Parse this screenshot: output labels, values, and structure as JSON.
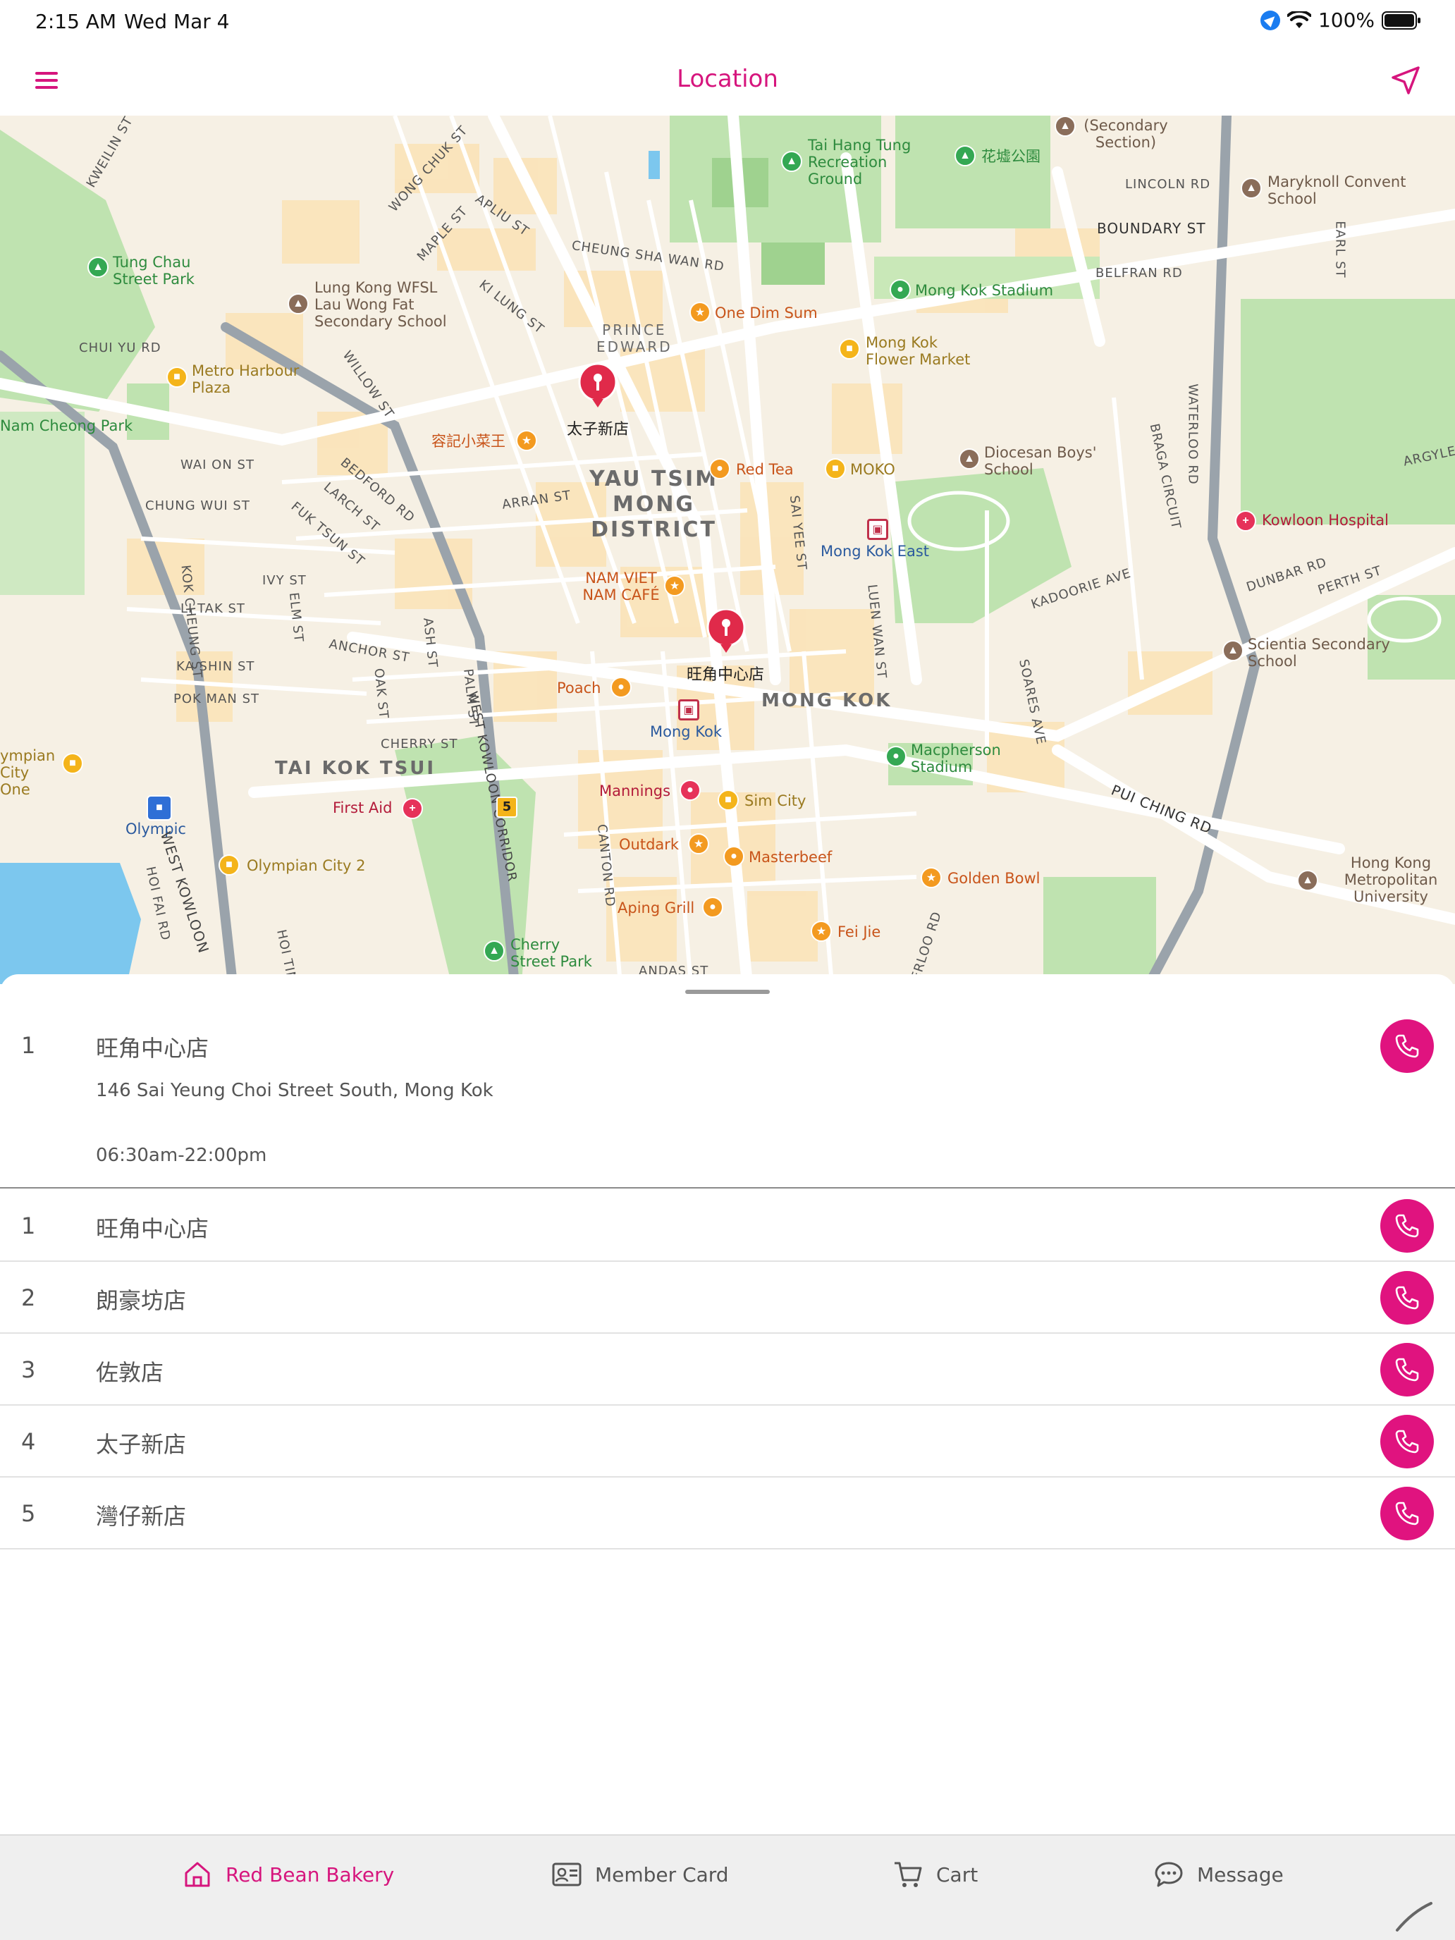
{
  "status_bar": {
    "time": "2:15 AM",
    "date": "Wed Mar 4",
    "battery": "100%"
  },
  "navbar": {
    "title": "Location",
    "menu_icon": "hamburger-menu-icon",
    "locate_icon": "navigation-arrow-icon"
  },
  "map": {
    "district_label": [
      "YAU TSIM",
      "MONG",
      "DISTRICT"
    ],
    "area_labels": {
      "mong_kok": "MONG KOK",
      "tai_kok_tsui": "TAI KOK TSUI",
      "prince_edward": [
        "PRINCE",
        "EDWARD"
      ]
    },
    "pins": [
      {
        "label": "太子新店"
      },
      {
        "label": "旺角中心店"
      }
    ],
    "parks": [
      "Tung Chau Street Park",
      "Tai Hang Tung Recreation Ground",
      "花墟公園",
      "Mong Kok Stadium",
      "Nam Cheong Park",
      "Macpherson Stadium",
      "Cherry Street Park"
    ],
    "food": [
      "One Dim Sum",
      "容記小菜王",
      "Red Tea",
      "NAM VIET NAM CAFÉ",
      "Poach",
      "Outdark",
      "Masterbeef",
      "Aping Grill",
      "Golden Bowl",
      "Fei Jie"
    ],
    "shops": [
      "Metro Harbour Plaza",
      "Mong Kok Flower Market",
      "MOKO",
      "Sim City",
      "Olympian City 2",
      "ympian City One"
    ],
    "schools": [
      "Lung Kong WFSL Lau Wong Fat Secondary School",
      "Maryknoll Convent School",
      "Diocesan Boys' School",
      "Scientia Secondary School",
      "Hong Kong Metropolitan University",
      "(Secondary Section)"
    ],
    "stations": [
      "Mong Kok East",
      "Mong Kok",
      "Olympic"
    ],
    "health": [
      "Kowloon Hospital",
      "First Aid",
      "Mannings"
    ],
    "roads": [
      "BOUNDARY ST",
      "WATERLOO RD",
      "ARGYLE S",
      "PUI CHING RD",
      "WEST KOWLOON CORRIDOR",
      "CHEUNG SHA WAN RD",
      "LINCOLN RD",
      "BELFRAN RD",
      "KADOORIE AVE",
      "DUNBAR RD",
      "PERTH ST",
      "SOARES AVE",
      "BRAGA CIRCUIT",
      "ARRAN ST",
      "SAI YEE ST",
      "LUEN WAN ST",
      "CANTON RD",
      "CHUNG WUI ST",
      "WAI ON ST",
      "CHUI YU RD",
      "KWEILIN ST",
      "WONG CHUK ST",
      "APLIU ST",
      "MAPLE ST",
      "KI LUNG ST",
      "WILLOW ST",
      "BEDFORD RD",
      "LARCH ST",
      "FUK TSUN ST",
      "IVY ST",
      "LI TAK ST",
      "ELM ST",
      "KA SHIN ST",
      "ANCHOR ST",
      "OAK ST",
      "ASH ST",
      "PALM ST",
      "POK MAN ST",
      "CHERRY ST",
      "KOK CHEUNG ST",
      "HOI FAI RD",
      "HOI TIN",
      "WEST KOWLOON",
      "EARL ST",
      "ERLOO RD",
      "ANDAS ST"
    ],
    "route_shield": "5"
  },
  "selected_store": {
    "index": "1",
    "name": "旺角中心店",
    "address": "146 Sai Yeung Choi Street South, Mong Kok",
    "hours": "06:30am-22:00pm"
  },
  "stores": [
    {
      "index": "1",
      "name": "旺角中心店"
    },
    {
      "index": "2",
      "name": "朗豪坊店"
    },
    {
      "index": "3",
      "name": "佐敦店"
    },
    {
      "index": "4",
      "name": "太子新店"
    },
    {
      "index": "5",
      "name": "灣仔新店"
    }
  ],
  "tabs": [
    {
      "label": "Red Bean Bakery",
      "icon": "home-icon",
      "active": true
    },
    {
      "label": "Member Card",
      "icon": "id-card-icon",
      "active": false
    },
    {
      "label": "Cart",
      "icon": "cart-icon",
      "active": false
    },
    {
      "label": "Message",
      "icon": "chat-bubble-icon",
      "active": false
    }
  ],
  "colors": {
    "accent": "#d6157d",
    "phone_button": "#e0137f",
    "tab_bar_bg": "#efefef"
  }
}
